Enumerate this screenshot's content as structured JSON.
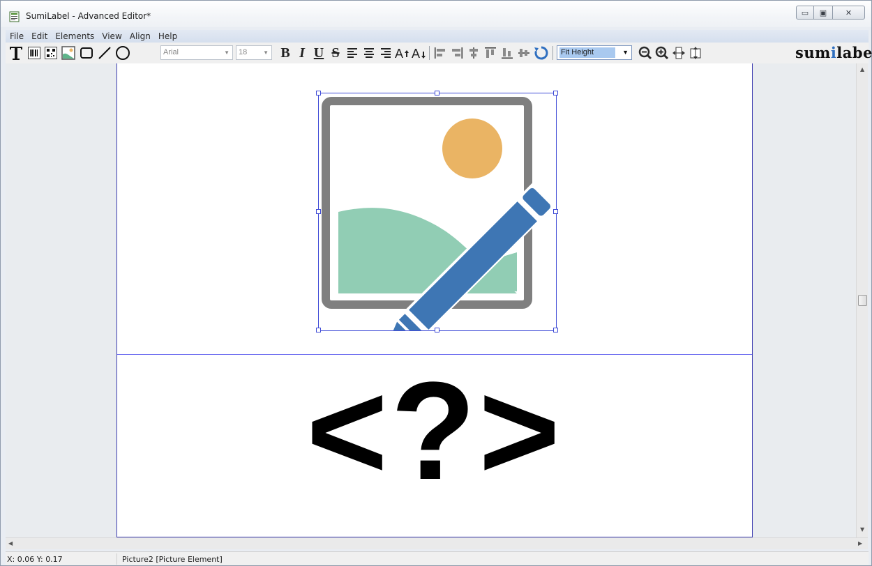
{
  "window": {
    "title": "SumiLabel - Advanced Editor*",
    "controls": {
      "minimize": "▭",
      "maximize": "▣",
      "close": "✕"
    }
  },
  "menu": [
    "File",
    "Edit",
    "Elements",
    "View",
    "Align",
    "Help"
  ],
  "toolbar": {
    "tools": [
      {
        "name": "text-tool-icon"
      },
      {
        "name": "barcode-tool-icon"
      },
      {
        "name": "qrcode-tool-icon"
      },
      {
        "name": "picture-tool-icon"
      },
      {
        "name": "rectangle-tool-icon"
      },
      {
        "name": "line-tool-icon"
      },
      {
        "name": "ellipse-tool-icon"
      }
    ],
    "font_family": "Arial",
    "font_size": "18",
    "format": {
      "bold": "B",
      "italic": "I",
      "underline": "U",
      "strike": "S"
    },
    "zoom": "Fit Height",
    "brand": {
      "pre": "sum",
      "i": "i",
      "post": "label"
    }
  },
  "label": {
    "placeholder": "<?>"
  },
  "status": {
    "coords": "X: 0.06 Y: 0.17",
    "selection": "Picture2 [Picture Element]"
  },
  "colors": {
    "frame": "#7f7f7f",
    "sun": "#eab464",
    "hill": "#91cdb4",
    "pencil": "#3e76b4",
    "selection": "#3f4bd6"
  }
}
